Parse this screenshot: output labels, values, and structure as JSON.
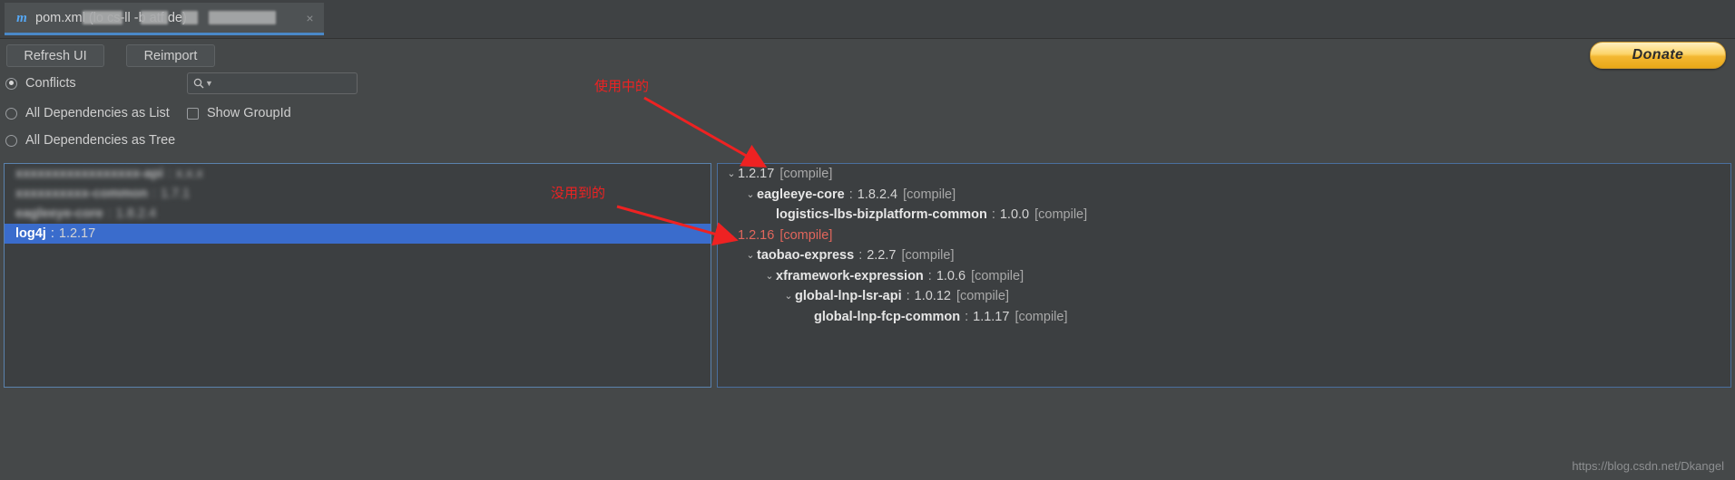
{
  "window": {
    "tab": {
      "icon": "maven-m-icon",
      "label": "pom.xml (lo       cs-ll   -b     atf             de)",
      "close": "×"
    }
  },
  "toolbar": {
    "refresh_label": "Refresh UI",
    "reimport_label": "Reimport",
    "donate_label": "Donate"
  },
  "options": {
    "conflicts_label": "Conflicts",
    "all_dependencies_as_list_label": "All Dependencies as List",
    "all_dependencies_as_tree_label": "All Dependencies as Tree",
    "show_groupid_label": "Show GroupId",
    "selected_radio": "Conflicts",
    "show_groupid_checked": false,
    "search": {
      "value": "",
      "placeholder": "",
      "icon": "search-icon"
    }
  },
  "left_list": {
    "rows": [
      {
        "artifact": "xxxxxxxxxxxxxxxxx-api",
        "version": "x.x.x",
        "redacted": true,
        "selected": false
      },
      {
        "artifact": "xxxxxxxxxx-common",
        "version": "1.7.1",
        "redacted": true,
        "selected": false
      },
      {
        "artifact": "eagleeye-core",
        "version": "1.8.2.4",
        "redacted": true,
        "selected": false
      },
      {
        "artifact": "log4j",
        "version": "1.2.17",
        "redacted": false,
        "selected": true
      }
    ]
  },
  "right_tree": {
    "rows": [
      {
        "indent": 0,
        "expandable": true,
        "artifact": "",
        "version": "1.2.17",
        "scope": "[compile]",
        "conflict": false
      },
      {
        "indent": 1,
        "expandable": true,
        "artifact": "eagleeye-core",
        "version": "1.8.2.4",
        "scope": "[compile]",
        "conflict": false
      },
      {
        "indent": 2,
        "expandable": false,
        "artifact": "logistics-lbs-bizplatform-common",
        "version": "1.0.0",
        "scope": "[compile]",
        "conflict": false
      },
      {
        "indent": 0,
        "expandable": true,
        "artifact": "",
        "version": "1.2.16",
        "scope": "[compile]",
        "conflict": true
      },
      {
        "indent": 1,
        "expandable": true,
        "artifact": "taobao-express",
        "version": "2.2.7",
        "scope": "[compile]",
        "conflict": false
      },
      {
        "indent": 2,
        "expandable": true,
        "artifact": "xframework-expression",
        "version": "1.0.6",
        "scope": "[compile]",
        "conflict": false
      },
      {
        "indent": 3,
        "expandable": true,
        "artifact": "global-lnp-lsr-api",
        "version": "1.0.12",
        "scope": "[compile]",
        "conflict": false
      },
      {
        "indent": 4,
        "expandable": false,
        "artifact": "global-lnp-fcp-common",
        "version": "1.1.17",
        "scope": "[compile]",
        "conflict": false
      }
    ],
    "chevron_glyph": "⌄"
  },
  "annotations": {
    "used": "使用中的",
    "unused": "没用到的",
    "color": "#ee2222"
  },
  "watermark": {
    "text": "https://blog.csdn.net/Dkangel"
  },
  "colors": {
    "accent": "#4a88c7",
    "selection": "#3a6ccc",
    "conflict": "#e2665c",
    "donate": "#f3b833",
    "background": "#3c3f41"
  }
}
